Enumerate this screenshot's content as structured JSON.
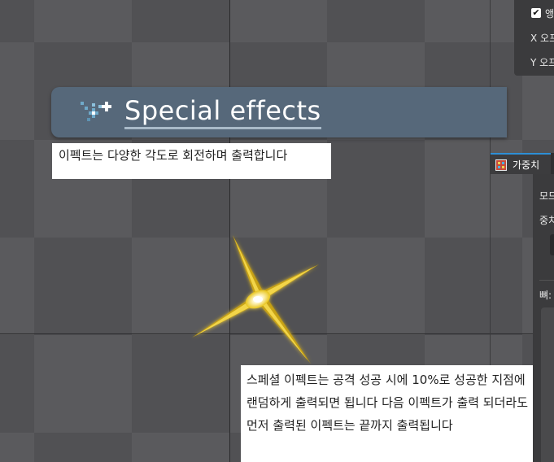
{
  "banner": {
    "title": "Special effects"
  },
  "captions": {
    "rotation_note": "이펙트는 다양한 각도로 회전하며 출력합니다",
    "trigger_note": "스페셜 이펙트는 공격 성공 시에 10%로 성공한 지점에 랜덤하게 출력되면 됩니다 다음 이펙트가 출력 되더라도 먼저 출력된 이펙트는 끝까지 출력됩니다"
  },
  "inspector_top": {
    "checkbox_label": "앵",
    "checked": true,
    "x_offset_label": "X 오프",
    "y_offset_label": "Y 오프"
  },
  "weights_panel": {
    "tab_label": "가중치",
    "tab_icon": "weights-grid-icon",
    "mode_label": "모드",
    "weight_label": "중치",
    "bones_label": "뼈:"
  },
  "colors": {
    "banner_bg": "#56687a",
    "sparkle_core": "#fff6c8",
    "sparkle_glow": "#e8c41a",
    "tab_accent": "#2d8fd6"
  },
  "icons": [
    "connected-nodes-icon",
    "sparkle-effect",
    "checkbox-icon",
    "weights-grid-icon"
  ]
}
